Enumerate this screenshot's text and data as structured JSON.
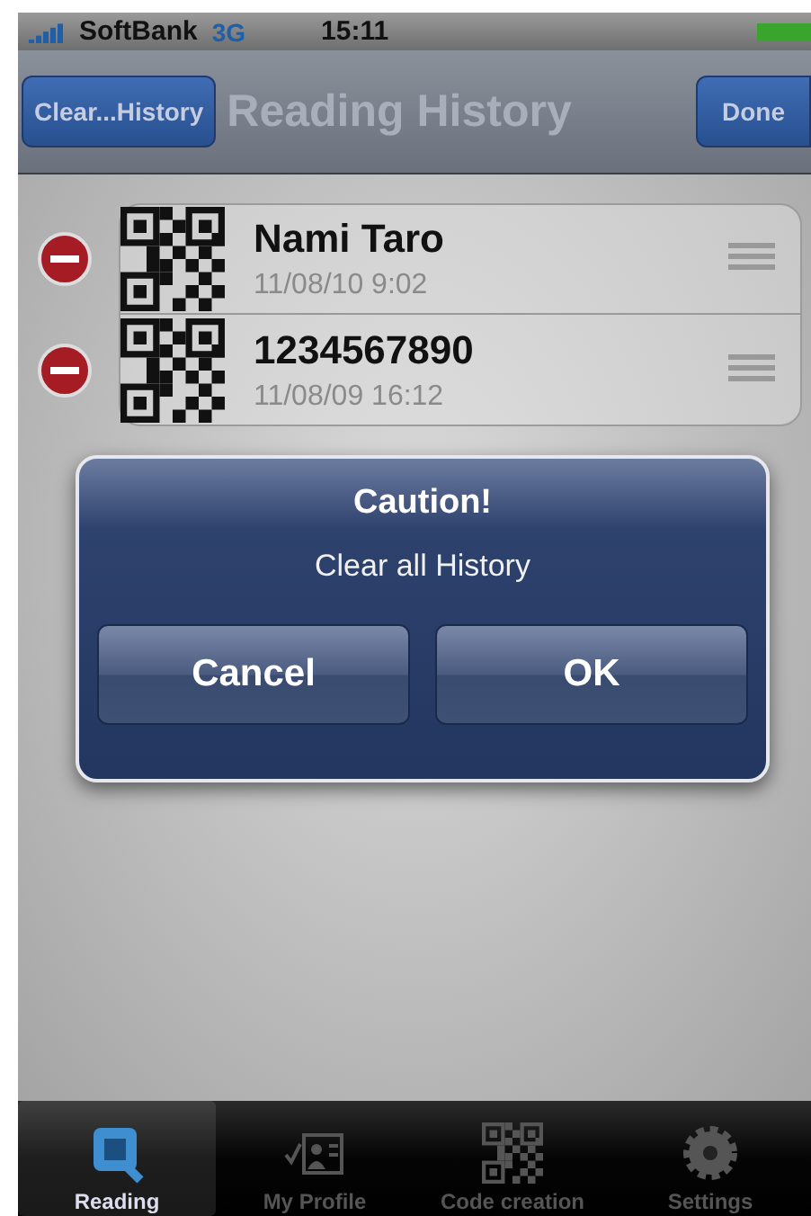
{
  "status_bar": {
    "carrier": "SoftBank",
    "network": "3G",
    "time": "15:11"
  },
  "nav_bar": {
    "left_button": "Clear...History",
    "title": "Reading History",
    "right_button": "Done"
  },
  "history": [
    {
      "title": "Nami Taro",
      "date": "11/08/10 9:02"
    },
    {
      "title": "1234567890",
      "date": "11/08/09 16:12"
    }
  ],
  "alert": {
    "title": "Caution!",
    "message": "Clear all History",
    "buttons": [
      "Cancel",
      "OK"
    ]
  },
  "tab_bar": [
    {
      "label": "Reading",
      "kind": "reading",
      "selected": true
    },
    {
      "label": "My Profile",
      "kind": "profile",
      "selected": false
    },
    {
      "label": "Code creation",
      "kind": "code",
      "selected": false
    },
    {
      "label": "Settings",
      "kind": "settings",
      "selected": false
    }
  ]
}
